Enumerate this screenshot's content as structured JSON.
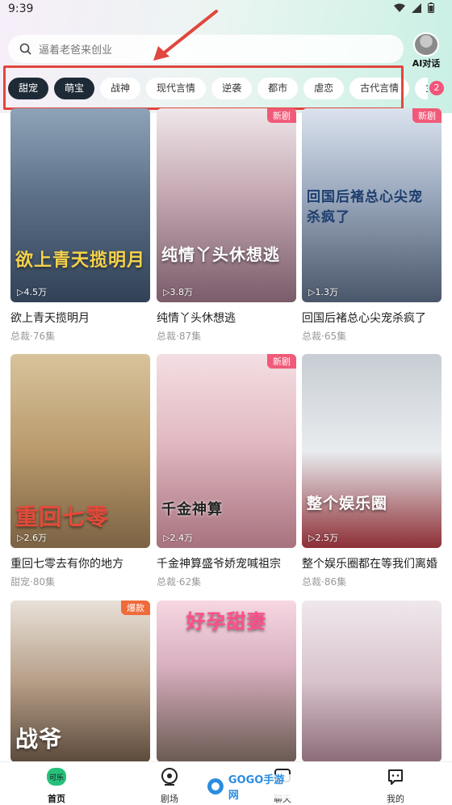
{
  "status_bar": {
    "time": "9:39"
  },
  "search": {
    "placeholder": "逼着老爸来创业"
  },
  "ai_chat": {
    "label": "AI对话"
  },
  "categories": [
    "甜宠",
    "萌宝",
    "战神",
    "现代言情",
    "逆袭",
    "都市",
    "虐恋",
    "古代言情",
    "女强"
  ],
  "categories_badge": "2",
  "dramas": [
    {
      "title": "欲上青天揽明月",
      "genre": "总裁·76集",
      "plays": "▷4.5万",
      "badge": "",
      "cover_text": "欲上青天揽明月"
    },
    {
      "title": "纯情丫头休想逃",
      "genre": "总裁·87集",
      "plays": "▷3.8万",
      "badge": "新剧",
      "cover_text": "纯情丫头休想逃"
    },
    {
      "title": "回国后褚总心尖宠杀疯了",
      "genre": "总裁·65集",
      "plays": "▷1.3万",
      "badge": "新剧",
      "cover_text": "回国后褚总心尖宠杀疯了"
    },
    {
      "title": "重回七零去有你的地方",
      "genre": "甜宠·80集",
      "plays": "▷2.6万",
      "badge": "",
      "cover_text": "重回七零"
    },
    {
      "title": "千金神算盛爷娇宠喊祖宗",
      "genre": "总裁·62集",
      "plays": "▷2.4万",
      "badge": "新剧",
      "cover_text": "千金神算"
    },
    {
      "title": "整个娱乐圈都在等我们离婚",
      "genre": "总裁·86集",
      "plays": "▷2.5万",
      "badge": "",
      "cover_text": "整个娱乐圈"
    },
    {
      "title": "",
      "genre": "",
      "plays": "",
      "badge": "爆款",
      "cover_text": "战爷"
    },
    {
      "title": "",
      "genre": "",
      "plays": "",
      "badge": "",
      "cover_text": "好孕甜妻"
    },
    {
      "title": "",
      "genre": "",
      "plays": "",
      "badge": "",
      "cover_text": ""
    }
  ],
  "bottom_nav": [
    {
      "label": "首页",
      "icon": "home-logo-icon",
      "active": true
    },
    {
      "label": "剧场",
      "icon": "theater-icon",
      "active": false
    },
    {
      "label": "聊天",
      "icon": "chat-icon",
      "active": false
    },
    {
      "label": "我的",
      "icon": "profile-icon",
      "active": false
    }
  ],
  "watermark": {
    "text": "GOGO手游网"
  },
  "colors": {
    "accent_dark": "#1e2a36",
    "badge_pink": "#f05a78",
    "annotation_red": "#e0473e"
  }
}
